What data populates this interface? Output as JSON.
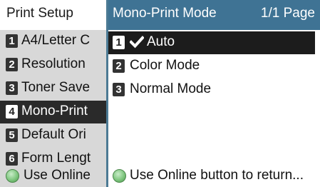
{
  "left_panel": {
    "title": "Print Setup",
    "items": [
      {
        "num": "1",
        "label": "A4/Letter C"
      },
      {
        "num": "2",
        "label": "Resolution"
      },
      {
        "num": "3",
        "label": "Toner Save"
      },
      {
        "num": "4",
        "label": "Mono-Print"
      },
      {
        "num": "5",
        "label": "Default Ori"
      },
      {
        "num": "6",
        "label": "Form Lengt"
      }
    ],
    "selected_index": 3,
    "footer": "Use Online"
  },
  "right_panel": {
    "title": "Mono-Print Mode",
    "page": "1/1 Page",
    "options": [
      {
        "num": "1",
        "label": "Auto",
        "checked": true
      },
      {
        "num": "2",
        "label": "Color Mode",
        "checked": false
      },
      {
        "num": "3",
        "label": "Normal Mode",
        "checked": false
      }
    ],
    "selected_index": 0,
    "footer": "Use Online button to return..."
  },
  "icons": {
    "checkmark": "check-icon",
    "online_button": "online-button-icon"
  },
  "colors": {
    "title_bar": "#3f7394",
    "left_bg": "#d8d8d8",
    "selection": "#1c1c1c",
    "online_button": "#7fc67f"
  }
}
